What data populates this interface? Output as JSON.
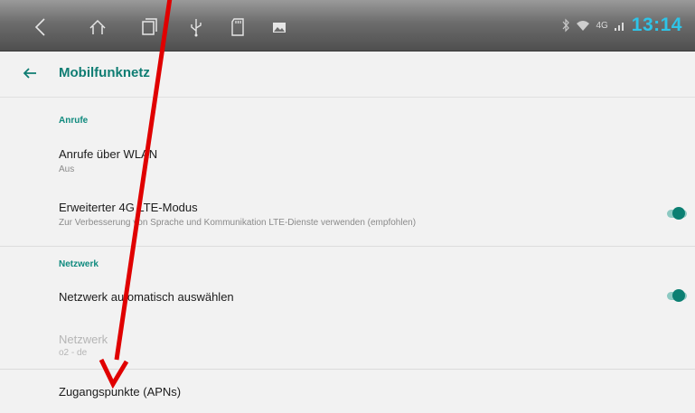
{
  "statusbar": {
    "time": "13:14",
    "network_type": "4G",
    "icons": [
      "back-icon",
      "home-icon",
      "recents-icon",
      "usb-icon",
      "sd-card-icon",
      "image-icon",
      "bluetooth-icon",
      "wifi-icon",
      "signal-icon"
    ]
  },
  "appbar": {
    "title": "Mobilfunknetz"
  },
  "sections": {
    "calls": {
      "header": "Anrufe",
      "wifi_calling": {
        "title": "Anrufe über WLAN",
        "summary": "Aus"
      },
      "lte_mode": {
        "title": "Erweiterter 4G LTE-Modus",
        "summary": "Zur Verbesserung von Sprache und Kommunikation LTE-Dienste verwenden (empfohlen)",
        "enabled": true
      }
    },
    "network": {
      "header": "Netzwerk",
      "auto_select": {
        "title": "Netzwerk automatisch auswählen",
        "enabled": true
      },
      "network": {
        "title": "Netzwerk",
        "summary": "o2 - de"
      },
      "apn": {
        "title": "Zugangspunkte (APNs)"
      }
    }
  },
  "colors": {
    "accent": "#0f8a7e",
    "time": "#2ec4e8",
    "annotation_arrow": "#e00000"
  }
}
